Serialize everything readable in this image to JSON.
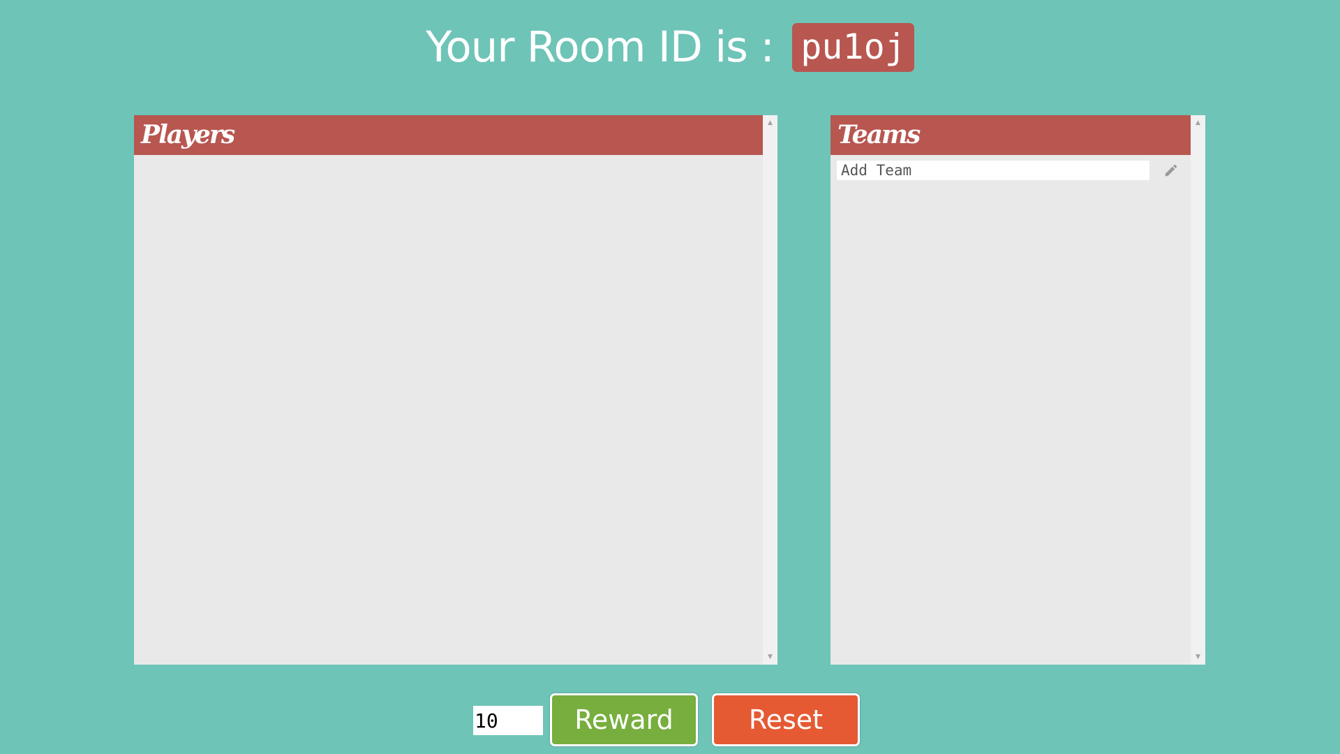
{
  "header": {
    "title_text": "Your Room ID is :",
    "room_id": "pu1oj"
  },
  "players_panel": {
    "title": "Players",
    "items": []
  },
  "teams_panel": {
    "title": "Teams",
    "add_team_placeholder": "Add Team",
    "add_team_value": "",
    "items": []
  },
  "controls": {
    "points_value": "10",
    "reward_label": "Reward",
    "reset_label": "Reset"
  },
  "colors": {
    "background": "#6ec4b7",
    "accent": "#b85650",
    "panel": "#e9e9e9",
    "reward": "#77ae3e",
    "reset": "#e55a33"
  },
  "icons": {
    "edit": "pencil-icon",
    "scroll_up": "scroll-up-arrow-icon",
    "scroll_down": "scroll-down-arrow-icon"
  }
}
